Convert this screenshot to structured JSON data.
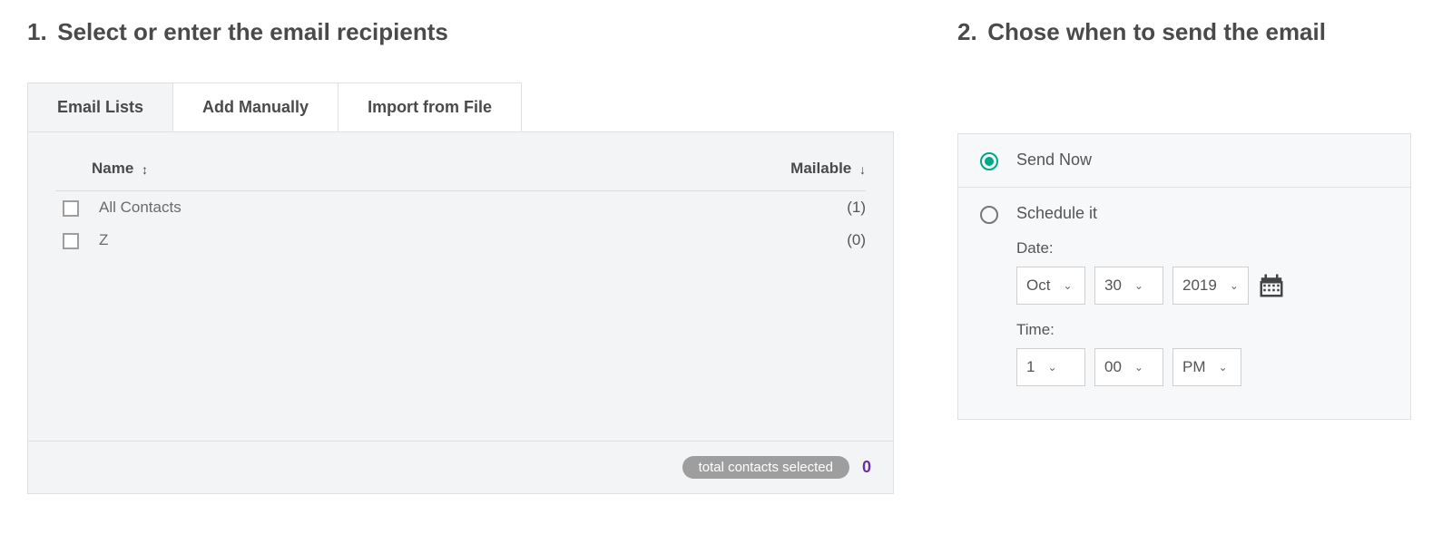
{
  "left": {
    "title_num": "1.",
    "title": "Select or enter the email recipients",
    "tabs": [
      {
        "label": "Email Lists",
        "active": true
      },
      {
        "label": "Add Manually",
        "active": false
      },
      {
        "label": "Import from File",
        "active": false
      }
    ],
    "columns": {
      "name": "Name",
      "mailable": "Mailable"
    },
    "rows": [
      {
        "name": "All Contacts",
        "mailable": "(1)"
      },
      {
        "name": "Z",
        "mailable": "(0)"
      }
    ],
    "footer_pill": "total contacts selected",
    "footer_count": "0"
  },
  "right": {
    "title_num": "2.",
    "title": "Chose when to send the email",
    "option_send_now": "Send Now",
    "option_schedule": "Schedule it",
    "date_label": "Date:",
    "time_label": "Time:",
    "date": {
      "month": "Oct",
      "day": "30",
      "year": "2019"
    },
    "time": {
      "hour": "1",
      "minute": "00",
      "ampm": "PM"
    }
  }
}
